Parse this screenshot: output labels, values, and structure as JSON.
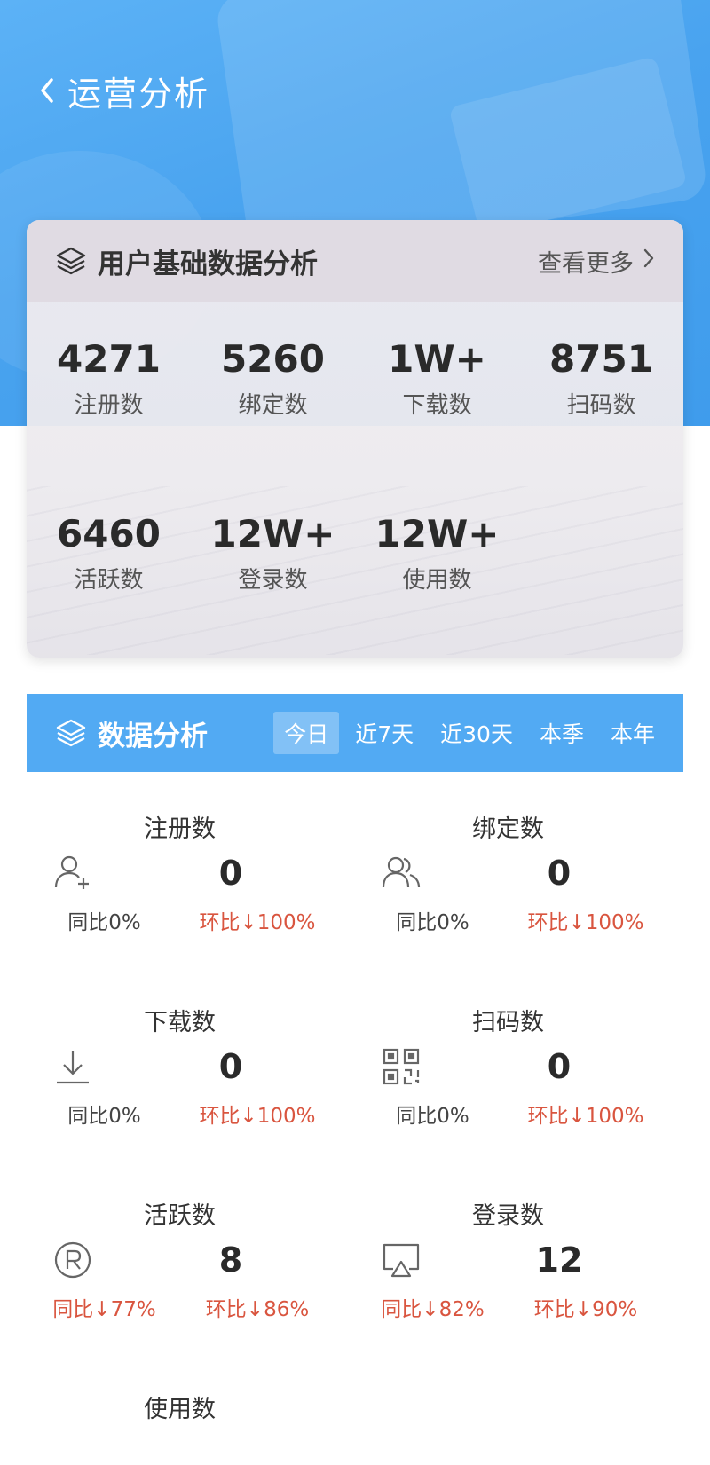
{
  "header": {
    "title": "运营分析"
  },
  "user_card": {
    "title": "用户基础数据分析",
    "more_label": "查看更多",
    "stats": [
      {
        "value": "4271",
        "label": "注册数"
      },
      {
        "value": "5260",
        "label": "绑定数"
      },
      {
        "value": "1W+",
        "label": "下载数"
      },
      {
        "value": "8751",
        "label": "扫码数"
      },
      {
        "value": "6460",
        "label": "活跃数"
      },
      {
        "value": "12W+",
        "label": "登录数"
      },
      {
        "value": "12W+",
        "label": "使用数"
      }
    ]
  },
  "analysis": {
    "title": "数据分析",
    "tabs": [
      "今日",
      "近7天",
      "近30天",
      "本季",
      "本年"
    ],
    "active_tab": "今日",
    "metrics": [
      {
        "name": "注册数",
        "icon": "add-user-icon",
        "value": "0",
        "yoy": "同比0%",
        "mom": "环比↓100%"
      },
      {
        "name": "绑定数",
        "icon": "users-icon",
        "value": "0",
        "yoy": "同比0%",
        "mom": "环比↓100%"
      },
      {
        "name": "下载数",
        "icon": "download-icon",
        "value": "0",
        "yoy": "同比0%",
        "mom": "环比↓100%"
      },
      {
        "name": "扫码数",
        "icon": "qr-code-icon",
        "value": "0",
        "yoy": "同比0%",
        "mom": "环比↓100%"
      },
      {
        "name": "活跃数",
        "icon": "registered-icon",
        "value": "8",
        "yoy": "同比↓77%",
        "mom": "环比↓86%"
      },
      {
        "name": "登录数",
        "icon": "screen-cast-icon",
        "value": "12",
        "yoy": "同比↓82%",
        "mom": "环比↓90%"
      },
      {
        "name": "使用数"
      }
    ]
  },
  "colors": {
    "primary": "#52aaf3",
    "decrease": "#d9553f",
    "text": "#2a2a2a"
  }
}
